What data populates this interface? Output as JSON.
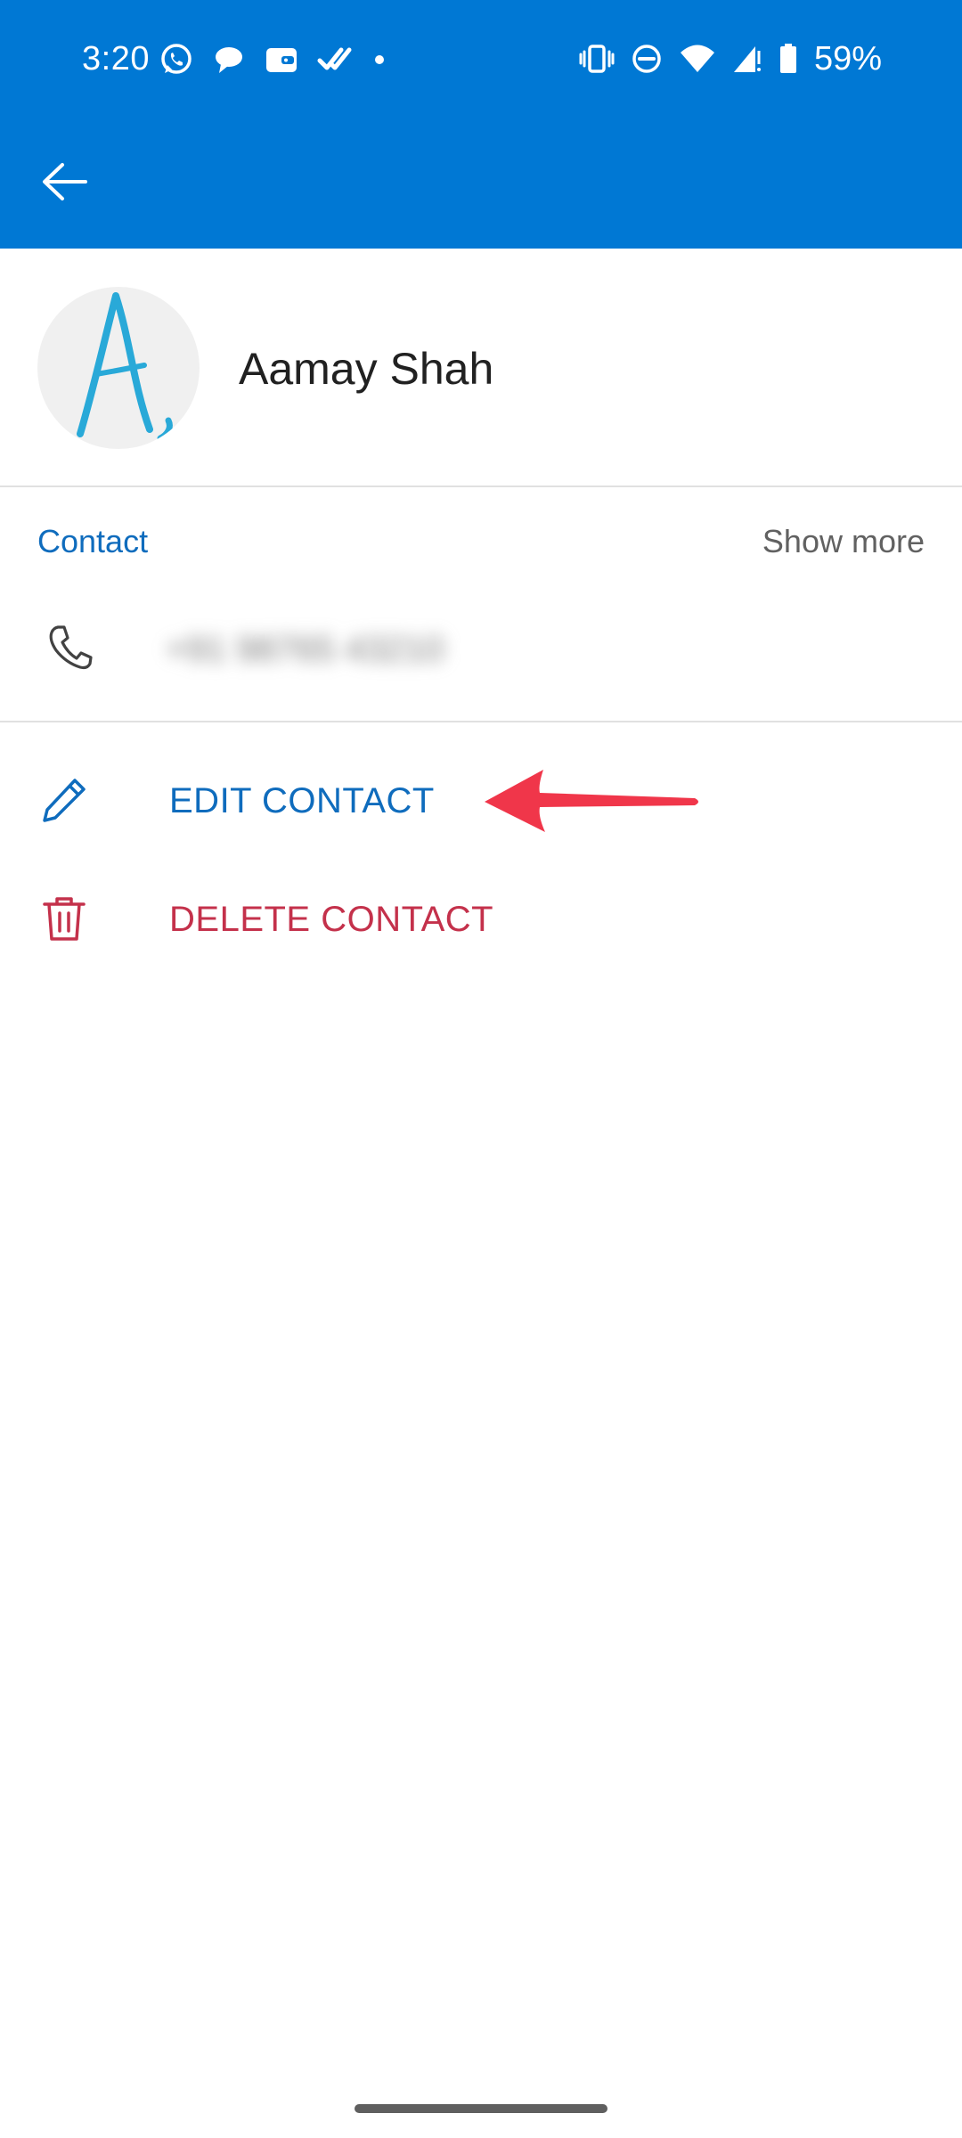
{
  "status_bar": {
    "time": "3:20",
    "battery_percent": "59%",
    "left_icons": [
      "whatsapp-icon",
      "chat-bubble-icon",
      "wallet-icon",
      "double-check-icon",
      "notification-dot-icon"
    ],
    "right_icons": [
      "vibrate-icon",
      "do-not-disturb-icon",
      "wifi-icon",
      "cell-signal-icon",
      "battery-icon"
    ]
  },
  "app_bar": {
    "back_icon": "arrow-left-icon",
    "background_color": "#0078d4"
  },
  "contact": {
    "name": "Aamay Shah",
    "avatar_icon": "handwritten-initial-avatar"
  },
  "section": {
    "title": "Contact",
    "show_more": "Show more"
  },
  "phone": {
    "icon": "phone-icon",
    "value": "+91 98765 43210",
    "redacted": true
  },
  "actions": {
    "edit": {
      "label": "EDIT CONTACT",
      "icon": "pencil-icon",
      "color": "#0f6cbd"
    },
    "delete": {
      "label": "DELETE CONTACT",
      "icon": "trash-icon",
      "color": "#c4314b"
    }
  },
  "annotation": {
    "icon": "red-arrow-annotation",
    "color": "#f0364a"
  }
}
